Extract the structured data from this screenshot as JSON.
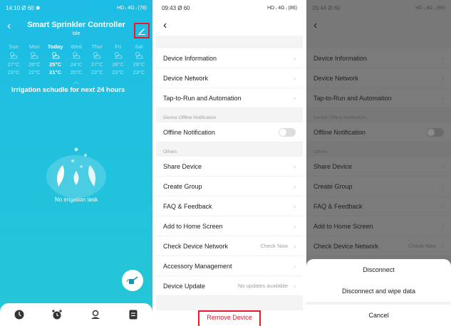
{
  "screen1": {
    "status": {
      "time": "14:10",
      "left_icons": "Ø 60 ✱",
      "right": "HD ᵢ 4G ᵢ (78)"
    },
    "title": "Smart Sprinkler Controller",
    "subtitle": "Idle",
    "forecast": [
      {
        "day": "Sun",
        "high": "27°C",
        "low": "23°C"
      },
      {
        "day": "Mon",
        "high": "26°C",
        "low": "22°C"
      },
      {
        "day": "Today",
        "high": "25°C",
        "low": "21°C"
      },
      {
        "day": "Wed",
        "high": "24°C",
        "low": "20°C"
      },
      {
        "day": "Thur",
        "high": "27°C",
        "low": "22°C"
      },
      {
        "day": "Fri",
        "high": "28°C",
        "low": "23°C"
      },
      {
        "day": "Sat",
        "high": "29°C",
        "low": "23°C"
      }
    ],
    "schedule_title": "Irrigation schudle for next 24 hours",
    "empty_text": "No irrigation task",
    "tabs": [
      "clock-nav-icon",
      "alarm-clock-icon",
      "user-icon",
      "list-icon"
    ],
    "colors": {
      "bg_top": "#1dbde6",
      "bg_bottom": "#25c6d6",
      "highlight": "#e8192c"
    }
  },
  "screen2": {
    "status": {
      "time": "09:43",
      "left_icons": "Ø 60",
      "right": "HD ᵢ 4G ᵢ (86)"
    },
    "items_top": [
      "Device Information",
      "Device Network",
      "Tap-to-Run and Automation"
    ],
    "offline_section": "Device Offline Notification",
    "offline_label": "Offline Notification",
    "others_section": "Others",
    "items_others": [
      "Share Device",
      "Create Group",
      "FAQ & Feedback",
      "Add to Home Screen"
    ],
    "check_network": {
      "label": "Check Device Network",
      "value": "Check Now"
    },
    "accessory": "Accessory Management",
    "update": {
      "label": "Device Update",
      "value": "No updates available"
    },
    "remove": "Remove Device"
  },
  "screen3": {
    "status": {
      "time": "09:44",
      "left_icons": "Ø 60",
      "right": "HD ᵢ 4G ᵢ (86)"
    },
    "items_top": [
      "Device Information",
      "Device Network",
      "Tap-to-Run and Automation"
    ],
    "offline_section": "Device Offline Notification",
    "offline_label": "Offline Notification",
    "others_section": "Others",
    "items_others": [
      "Share Device",
      "Create Group",
      "FAQ & Feedback",
      "Add to Home Screen"
    ],
    "check_network": {
      "label": "Check Device Network",
      "value": "Check Now"
    },
    "sheet": {
      "disconnect": "Disconnect",
      "wipe": "Disconnect and wipe data",
      "cancel": "Cancel"
    }
  }
}
